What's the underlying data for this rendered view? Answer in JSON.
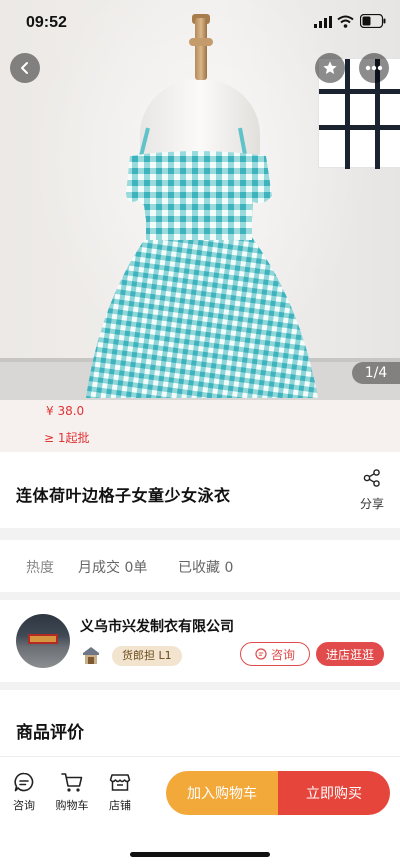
{
  "status_bar": {
    "time": "09:52"
  },
  "hero": {
    "pager": "1/4"
  },
  "product": {
    "price": "¥ 38.0",
    "moq": "≥ 1起批",
    "title": "连体荷叶边格子女童少女泳衣",
    "share_label": "分享"
  },
  "stats": {
    "heat": "热度",
    "monthly": "月成交 0单",
    "favorites": "已收藏 0"
  },
  "shop": {
    "name": "义乌市兴发制衣有限公司",
    "badge": "货郎担 L1",
    "consult": "咨询",
    "visit": "进店逛逛"
  },
  "reviews": {
    "title": "商品评价"
  },
  "bottom_bar": {
    "tabs": [
      {
        "label": "咨询",
        "icon": "chat-icon"
      },
      {
        "label": "购物车",
        "icon": "cart-icon"
      },
      {
        "label": "店铺",
        "icon": "shop-icon"
      }
    ],
    "add_to_cart": "加入购物车",
    "buy_now": "立即购买"
  },
  "colors": {
    "accent": "#e6453b",
    "cart": "#f3a83a",
    "dress": "#5fc3c9"
  }
}
